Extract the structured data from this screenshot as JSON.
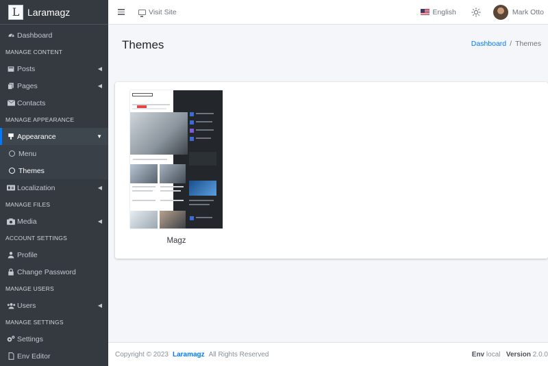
{
  "brand": {
    "logo_letter": "L",
    "name": "Laramagz"
  },
  "sidebar": {
    "items": [
      {
        "type": "item",
        "label": "Dashboard",
        "icon": "dashboard-icon"
      },
      {
        "type": "header",
        "label": "MANAGE CONTENT"
      },
      {
        "type": "item",
        "label": "Posts",
        "icon": "posts-icon",
        "chevron": true
      },
      {
        "type": "item",
        "label": "Pages",
        "icon": "pages-icon",
        "chevron": true
      },
      {
        "type": "item",
        "label": "Contacts",
        "icon": "envelope-icon"
      },
      {
        "type": "header",
        "label": "MANAGE APPEARANCE"
      },
      {
        "type": "item",
        "label": "Appearance",
        "icon": "appearance-icon",
        "open": true
      },
      {
        "type": "sub",
        "label": "Menu"
      },
      {
        "type": "sub",
        "label": "Themes",
        "active": true
      },
      {
        "type": "item",
        "label": "Localization",
        "icon": "localization-icon",
        "chevron": true
      },
      {
        "type": "header",
        "label": "MANAGE FILES"
      },
      {
        "type": "item",
        "label": "Media",
        "icon": "media-icon",
        "chevron": true
      },
      {
        "type": "header",
        "label": "ACCOUNT SETTINGS"
      },
      {
        "type": "item",
        "label": "Profile",
        "icon": "user-icon"
      },
      {
        "type": "item",
        "label": "Change Password",
        "icon": "lock-icon"
      },
      {
        "type": "header",
        "label": "MANAGE USERS"
      },
      {
        "type": "item",
        "label": "Users",
        "icon": "users-icon",
        "chevron": true
      },
      {
        "type": "header",
        "label": "MANAGE SETTINGS"
      },
      {
        "type": "item",
        "label": "Settings",
        "icon": "gears-icon"
      },
      {
        "type": "item",
        "label": "Env Editor",
        "icon": "file-icon"
      }
    ]
  },
  "topbar": {
    "visit_site": "Visit Site",
    "language": "English",
    "user_name": "Mark Otto"
  },
  "page": {
    "title": "Themes",
    "breadcrumb": {
      "home": "Dashboard",
      "separator": "/",
      "current": "Themes"
    }
  },
  "themes": [
    {
      "name": "Magz"
    }
  ],
  "footer": {
    "copyright": "Copyright © 2023",
    "brand": "Laramagz",
    "rights": "All Rights Reserved",
    "env_label": "Env",
    "env_value": "local",
    "version_label": "Version",
    "version_value": "2.0.0"
  },
  "colors": {
    "sidebar_bg": "#343a40",
    "accent": "#007bff",
    "content_bg": "#f4f6f9"
  }
}
